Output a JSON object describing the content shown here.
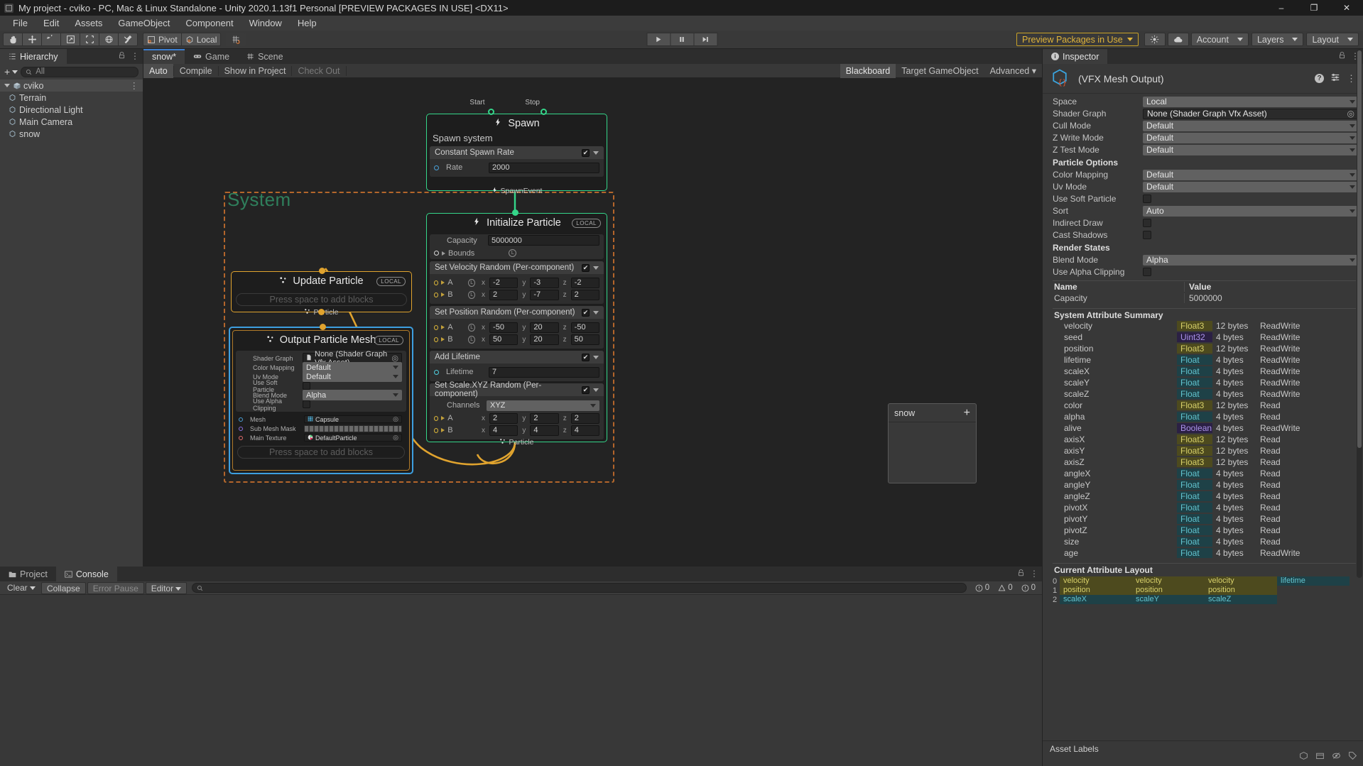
{
  "window": {
    "title": "My project - cviko - PC, Mac & Linux Standalone - Unity 2020.1.13f1 Personal [PREVIEW PACKAGES IN USE] <DX11>",
    "minimize": "–",
    "maximize": "❐",
    "close": "✕"
  },
  "menu": {
    "items": [
      "File",
      "Edit",
      "Assets",
      "GameObject",
      "Component",
      "Window",
      "Help"
    ]
  },
  "toolbar": {
    "tools": [
      "hand-icon",
      "move-icon",
      "rotate-icon",
      "scale-icon",
      "rect-icon",
      "transform-icon",
      "custom-tool-icon"
    ],
    "pivot": "Pivot",
    "local": "Local",
    "grid": "grid-snap-icon",
    "play": "play-icon",
    "pause": "pause-icon",
    "step": "step-icon",
    "preview_packages": "Preview Packages in Use",
    "collab": "cloud-icon",
    "services": "services-icon",
    "account": "Account",
    "layers": "Layers",
    "layout": "Layout"
  },
  "hierarchy": {
    "tab": "Hierarchy",
    "search_placeholder": "All",
    "items": [
      {
        "label": "cviko",
        "depth": 0,
        "icon": "scene-icon",
        "selected": true,
        "expanded": true
      },
      {
        "label": "Terrain",
        "depth": 1,
        "icon": "gameobject-icon",
        "selected": false
      },
      {
        "label": "Directional Light",
        "depth": 1,
        "icon": "gameobject-icon",
        "selected": false
      },
      {
        "label": "Main Camera",
        "depth": 1,
        "icon": "gameobject-icon",
        "selected": false
      },
      {
        "label": "snow",
        "depth": 1,
        "icon": "gameobject-icon",
        "selected": false
      }
    ]
  },
  "vfx_editor": {
    "tabs": [
      {
        "label": "snow*",
        "icon": "",
        "active": true
      },
      {
        "label": "Game",
        "icon": "gamepad-icon",
        "active": false
      },
      {
        "label": "Scene",
        "icon": "grid-icon",
        "active": false
      }
    ],
    "toolbar_left": [
      {
        "label": "Auto",
        "active": true
      },
      {
        "label": "Compile",
        "active": false
      },
      {
        "label": "Show in Project",
        "active": false
      },
      {
        "label": "Check Out",
        "active": false,
        "dim": true
      }
    ],
    "toolbar_right": [
      {
        "label": "Blackboard",
        "active": true
      },
      {
        "label": "Target GameObject",
        "active": false
      },
      {
        "label": "Advanced",
        "active": false,
        "dropdown": true
      }
    ],
    "system_label": "System",
    "nodes": {
      "spawn": {
        "title": "Spawn",
        "icon": "bolt-icon",
        "start_port": "Start",
        "stop_port": "Stop",
        "system_name": "Spawn system",
        "block": {
          "name": "Constant Spawn Rate",
          "rate_label": "Rate",
          "rate_value": "2000"
        },
        "out_port": "SpawnEvent",
        "color": "#35d68a"
      },
      "initialize": {
        "title": "Initialize Particle",
        "icon": "bolt-icon",
        "space": "LOCAL",
        "capacity_label": "Capacity",
        "capacity_value": "5000000",
        "bounds_label": "Bounds",
        "blocks": [
          {
            "name": "Set Velocity Random (Per-component)",
            "rows": [
              {
                "label": "A",
                "space": "L",
                "x": "-2",
                "y": "-3",
                "z": "-2"
              },
              {
                "label": "B",
                "space": "L",
                "x": "2",
                "y": "-7",
                "z": "2"
              }
            ]
          },
          {
            "name": "Set Position Random (Per-component)",
            "rows": [
              {
                "label": "A",
                "space": "L",
                "x": "-50",
                "y": "20",
                "z": "-50"
              },
              {
                "label": "B",
                "space": "L",
                "x": "50",
                "y": "20",
                "z": "50"
              }
            ]
          },
          {
            "name": "Add Lifetime",
            "lifetime_label": "Lifetime",
            "lifetime_value": "7"
          },
          {
            "name": "Set Scale.XYZ Random (Per-component)",
            "channels_label": "Channels",
            "channels_value": "XYZ",
            "rows": [
              {
                "label": "A",
                "x": "2",
                "y": "2",
                "z": "2"
              },
              {
                "label": "B",
                "x": "4",
                "y": "4",
                "z": "4"
              }
            ]
          }
        ],
        "out_port": "Particle",
        "color": "#35d68a"
      },
      "update": {
        "title": "Update Particle",
        "icon": "particle-icon",
        "space": "LOCAL",
        "placeholder": "Press space to add blocks",
        "out_port": "Particle",
        "color": "#e0a32e"
      },
      "output": {
        "title": "Output Particle Mesh",
        "icon": "particle-icon",
        "space": "LOCAL",
        "fields": [
          {
            "label": "Shader Graph",
            "value": "None (Shader Graph Vfx Asset)",
            "type": "object"
          },
          {
            "label": "Color Mapping",
            "value": "Default",
            "type": "enum"
          },
          {
            "label": "Uv Mode",
            "value": "Default",
            "type": "enum"
          },
          {
            "label": "Use Soft Particle",
            "value": "",
            "type": "toggle"
          },
          {
            "label": "Blend Mode",
            "value": "Alpha",
            "type": "enum"
          },
          {
            "label": "Use Alpha Clipping",
            "value": "",
            "type": "toggle"
          }
        ],
        "slots": [
          {
            "label": "Mesh",
            "value": "Capsule",
            "dot": "blue",
            "type": "object"
          },
          {
            "label": "Sub Mesh Mask",
            "value": "",
            "dot": "purple",
            "type": "bitmask"
          },
          {
            "label": "Main Texture",
            "value": "DefaultParticle",
            "dot": "red",
            "type": "object"
          }
        ],
        "placeholder": "Press space to add blocks",
        "color": "#3d9fe0"
      }
    },
    "blackboard": {
      "title": "snow",
      "add": "+"
    }
  },
  "console": {
    "tabs": [
      {
        "label": "Project",
        "icon": "folder-icon",
        "active": false
      },
      {
        "label": "Console",
        "icon": "console-icon",
        "active": true
      }
    ],
    "buttons": [
      "Clear",
      "Collapse",
      "Error Pause",
      "Editor"
    ],
    "search_placeholder": "",
    "counts": {
      "log": "0",
      "warning": "0",
      "error": "0"
    }
  },
  "inspector": {
    "tab": "Inspector",
    "title": "(VFX Mesh Output)",
    "icon": "vfx-mesh-output-icon",
    "properties": [
      {
        "label": "Space",
        "value": "Local",
        "type": "enum"
      },
      {
        "label": "Shader Graph",
        "value": "None (Shader Graph Vfx Asset)",
        "type": "object"
      },
      {
        "label": "Cull Mode",
        "value": "Default",
        "type": "enum"
      },
      {
        "label": "Z Write Mode",
        "value": "Default",
        "type": "enum"
      },
      {
        "label": "Z Test Mode",
        "value": "Default",
        "type": "enum"
      }
    ],
    "particle_options_header": "Particle Options",
    "particle_options": [
      {
        "label": "Color Mapping",
        "value": "Default",
        "type": "enum"
      },
      {
        "label": "Uv Mode",
        "value": "Default",
        "type": "enum"
      },
      {
        "label": "Use Soft Particle",
        "value": "",
        "type": "toggle"
      },
      {
        "label": "Sort",
        "value": "Auto",
        "type": "enum"
      },
      {
        "label": "Indirect Draw",
        "value": "",
        "type": "toggle"
      },
      {
        "label": "Cast Shadows",
        "value": "",
        "type": "toggle"
      }
    ],
    "render_states_header": "Render States",
    "render_states": [
      {
        "label": "Blend Mode",
        "value": "Alpha",
        "type": "enum"
      },
      {
        "label": "Use Alpha Clipping",
        "value": "",
        "type": "toggle"
      }
    ],
    "nv_header": {
      "name": "Name",
      "value": "Value"
    },
    "nv_rows": [
      {
        "name": "Capacity",
        "value": "5000000"
      }
    ],
    "attr_summary_header": "System Attribute Summary",
    "attributes": [
      {
        "name": "velocity",
        "type": "Float3",
        "bytes": "12 bytes",
        "access": "ReadWrite"
      },
      {
        "name": "seed",
        "type": "Uint32",
        "bytes": "4 bytes",
        "access": "ReadWrite"
      },
      {
        "name": "position",
        "type": "Float3",
        "bytes": "12 bytes",
        "access": "ReadWrite"
      },
      {
        "name": "lifetime",
        "type": "Float",
        "bytes": "4 bytes",
        "access": "ReadWrite"
      },
      {
        "name": "scaleX",
        "type": "Float",
        "bytes": "4 bytes",
        "access": "ReadWrite"
      },
      {
        "name": "scaleY",
        "type": "Float",
        "bytes": "4 bytes",
        "access": "ReadWrite"
      },
      {
        "name": "scaleZ",
        "type": "Float",
        "bytes": "4 bytes",
        "access": "ReadWrite"
      },
      {
        "name": "color",
        "type": "Float3",
        "bytes": "12 bytes",
        "access": "Read"
      },
      {
        "name": "alpha",
        "type": "Float",
        "bytes": "4 bytes",
        "access": "Read"
      },
      {
        "name": "alive",
        "type": "Boolean",
        "bytes": "4 bytes",
        "access": "ReadWrite"
      },
      {
        "name": "axisX",
        "type": "Float3",
        "bytes": "12 bytes",
        "access": "Read"
      },
      {
        "name": "axisY",
        "type": "Float3",
        "bytes": "12 bytes",
        "access": "Read"
      },
      {
        "name": "axisZ",
        "type": "Float3",
        "bytes": "12 bytes",
        "access": "Read"
      },
      {
        "name": "angleX",
        "type": "Float",
        "bytes": "4 bytes",
        "access": "Read"
      },
      {
        "name": "angleY",
        "type": "Float",
        "bytes": "4 bytes",
        "access": "Read"
      },
      {
        "name": "angleZ",
        "type": "Float",
        "bytes": "4 bytes",
        "access": "Read"
      },
      {
        "name": "pivotX",
        "type": "Float",
        "bytes": "4 bytes",
        "access": "Read"
      },
      {
        "name": "pivotY",
        "type": "Float",
        "bytes": "4 bytes",
        "access": "Read"
      },
      {
        "name": "pivotZ",
        "type": "Float",
        "bytes": "4 bytes",
        "access": "Read"
      },
      {
        "name": "size",
        "type": "Float",
        "bytes": "4 bytes",
        "access": "Read"
      },
      {
        "name": "age",
        "type": "Float",
        "bytes": "4 bytes",
        "access": "ReadWrite"
      }
    ],
    "layout_header": "Current Attribute Layout",
    "layout_rows": [
      {
        "index": "0",
        "cells": [
          {
            "text": "velocity",
            "kind": "vel"
          },
          {
            "text": "velocity",
            "kind": "vel"
          },
          {
            "text": "velocity",
            "kind": "vel"
          },
          {
            "text": "lifetime",
            "kind": "life"
          }
        ]
      },
      {
        "index": "1",
        "cells": [
          {
            "text": "position",
            "kind": "pos"
          },
          {
            "text": "position",
            "kind": "pos"
          },
          {
            "text": "position",
            "kind": "pos"
          },
          {
            "text": "",
            "kind": "empty"
          }
        ]
      },
      {
        "index": "2",
        "cells": [
          {
            "text": "scaleX",
            "kind": "scale"
          },
          {
            "text": "scaleY",
            "kind": "scale"
          },
          {
            "text": "scaleZ",
            "kind": "scale"
          },
          {
            "text": "",
            "kind": "empty"
          }
        ]
      }
    ],
    "asset_labels": "Asset Labels"
  },
  "colors": {
    "accent_green": "#35d68a",
    "accent_orange": "#e0a32e",
    "accent_blue": "#3d9fe0",
    "accent_red": "#d1622f",
    "preview_yellow": "#e0b43a"
  }
}
